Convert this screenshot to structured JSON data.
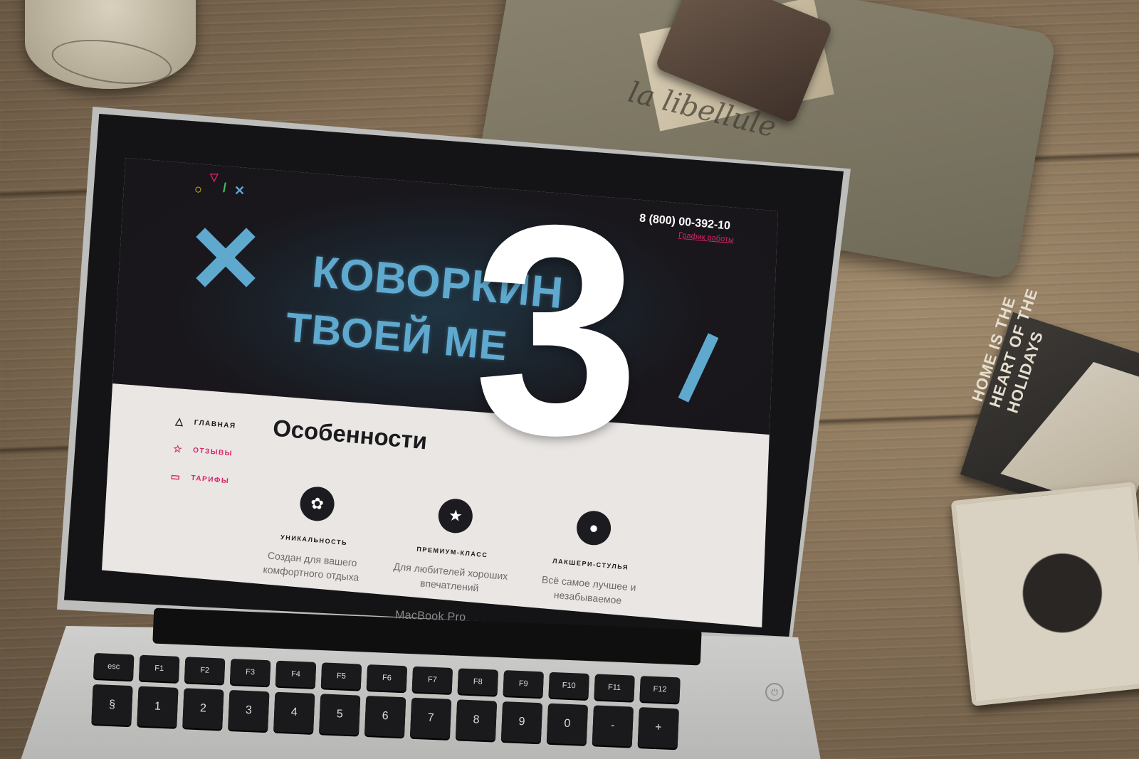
{
  "overlay": {
    "number": "3"
  },
  "props": {
    "pouch_text": "la libellule",
    "coaster_text": "HOME IS THE HEART OF THE HOLIDAYS"
  },
  "laptop": {
    "brand": "MacBook Pro"
  },
  "site": {
    "header": {
      "phone": "8 (800) 00-392-10",
      "schedule_link": "График работы"
    },
    "hero": {
      "line1": "КОВОРКИН",
      "line2": "ТВОЕЙ МЕ"
    },
    "nav": {
      "items": [
        {
          "label": "ГЛАВНАЯ",
          "icon": "triangle-icon"
        },
        {
          "label": "ОТЗЫВЫ",
          "icon": "star-icon"
        },
        {
          "label": "ТАРИФЫ",
          "icon": "wallet-icon"
        }
      ]
    },
    "features": {
      "title": "Особенности",
      "items": [
        {
          "title": "УНИКАЛЬНОСТЬ",
          "description": "Создан для вашего комфортного отдыха",
          "icon": "flower-icon"
        },
        {
          "title": "ПРЕМИУМ-КЛАСС",
          "description": "Для любителей хороших впечатлений",
          "icon": "star-icon"
        },
        {
          "title": "ЛАКШЕРИ-СТУЛЬЯ",
          "description": "Всё самое лучшее и незабываемое",
          "icon": "palette-icon"
        }
      ]
    }
  },
  "keyboard": {
    "fn_row": [
      "esc",
      "F1",
      "F2",
      "F3",
      "F4",
      "F5",
      "F6",
      "F7",
      "F8",
      "F9",
      "F10",
      "F11",
      "F12"
    ],
    "num_row": [
      "§",
      "1",
      "2",
      "3",
      "4",
      "5",
      "6",
      "7",
      "8",
      "9",
      "0",
      "-",
      "+"
    ]
  },
  "colors": {
    "accent_pink": "#d8226b",
    "hero_blue": "#5fa9cf",
    "dark": "#1c1b20"
  }
}
